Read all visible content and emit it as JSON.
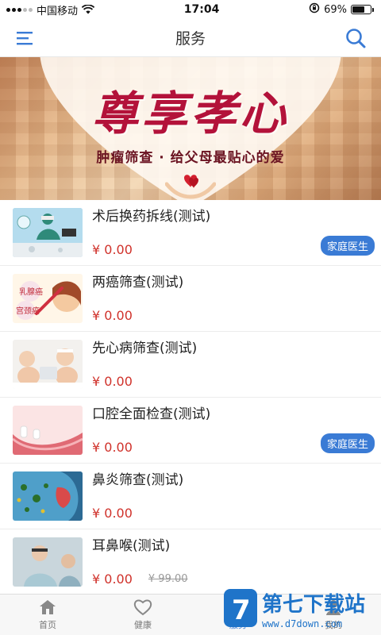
{
  "status_bar": {
    "carrier": "中国移动",
    "time": "17:04",
    "battery_percent": "69%",
    "battery_level": 0.69
  },
  "nav": {
    "title": "服务",
    "menu_icon": "menu-icon",
    "search_icon": "search-icon"
  },
  "banner": {
    "title": "尊享孝心",
    "subtitle": "肿瘤筛查 · 给父母最贴心的爱"
  },
  "services": [
    {
      "title": "术后换药拆线(测试)",
      "price": "¥ 0.00",
      "old_price": "",
      "tag": "家庭医生"
    },
    {
      "title": "两癌筛查(测试)",
      "price": "¥ 0.00",
      "old_price": "",
      "tag": ""
    },
    {
      "title": "先心病筛查(测试)",
      "price": "¥ 0.00",
      "old_price": "",
      "tag": ""
    },
    {
      "title": "口腔全面检查(测试)",
      "price": "¥ 0.00",
      "old_price": "",
      "tag": "家庭医生"
    },
    {
      "title": "鼻炎筛查(测试)",
      "price": "¥ 0.00",
      "old_price": "",
      "tag": ""
    },
    {
      "title": "耳鼻喉(测试)",
      "price": "¥ 0.00",
      "old_price": "¥ 99.00",
      "tag": ""
    }
  ],
  "thumb_labels": {
    "breast": "乳腺癌",
    "cervical": "宫颈癌"
  },
  "tabbar": [
    {
      "label": "首页",
      "icon": "home-icon"
    },
    {
      "label": "健康",
      "icon": "heart-icon"
    },
    {
      "label": "服务",
      "icon": "service-icon"
    },
    {
      "label": "我的",
      "icon": "user-icon"
    }
  ],
  "watermark": {
    "brand": "第七下载站",
    "url": "www.d7down.com"
  },
  "colors": {
    "accent": "#3a7bd5",
    "price": "#d0322b",
    "banner_title": "#b3123a"
  }
}
